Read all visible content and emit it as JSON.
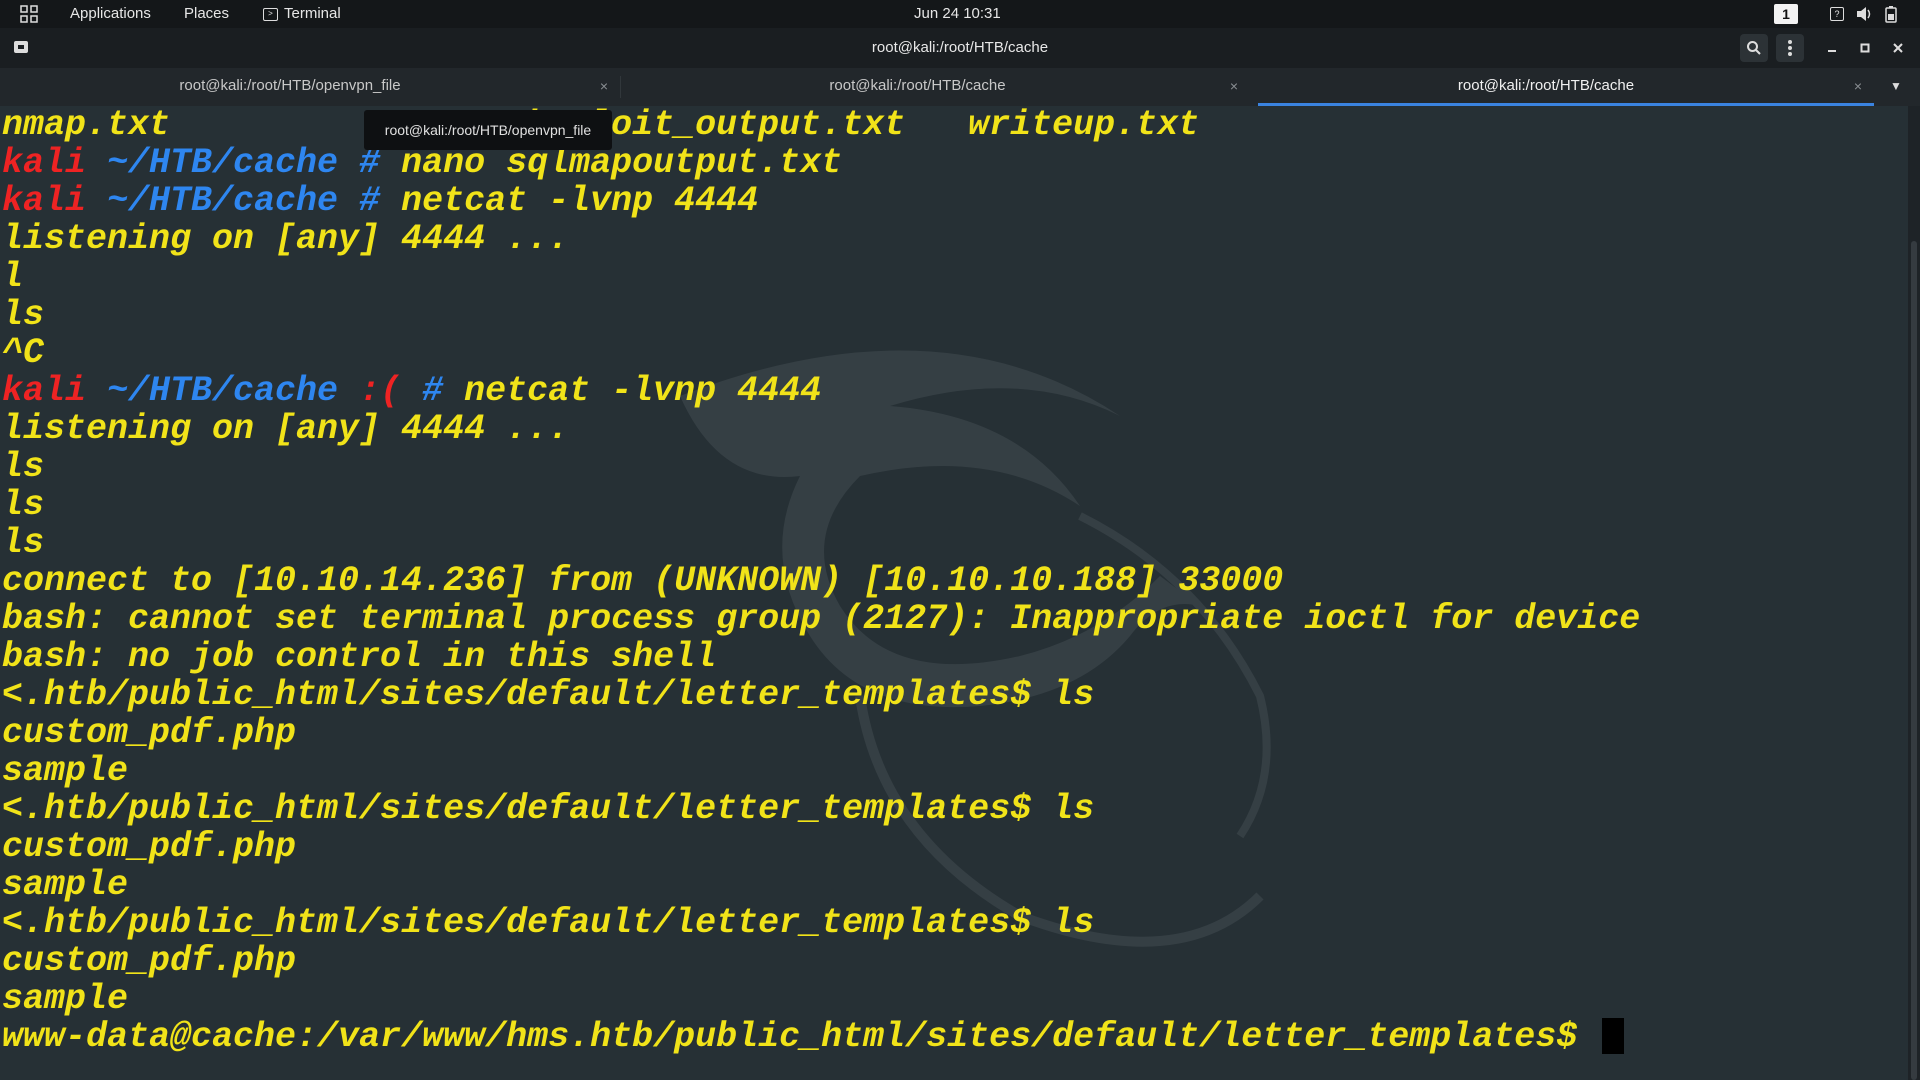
{
  "topbar": {
    "applications": "Applications",
    "places": "Places",
    "terminal": "Terminal",
    "clock": "Jun 24  10:31",
    "workspace": "1"
  },
  "titlebar": {
    "title": "root@kali:/root/HTB/cache"
  },
  "tabs": [
    {
      "label": "root@kali:/root/HTB/openvpn_file",
      "close": "×",
      "active": false
    },
    {
      "label": "root@kali:/root/HTB/cache",
      "close": "×",
      "active": false
    },
    {
      "label": "root@kali:/root/HTB/cache",
      "close": "×",
      "active": true
    }
  ],
  "tooltip": "root@kali:/root/HTB/openvpn_file",
  "terminal": {
    "lines": [
      "nmap.txt            searchsploit_output.txt   writeup.txt",
      "kali ~/HTB/cache # nano sqlmapoutput.txt",
      "kali ~/HTB/cache # netcat -lvnp 4444",
      "listening on [any] 4444 ...",
      "l",
      "ls",
      "^C",
      "kali ~/HTB/cache :( # netcat -lvnp 4444",
      "listening on [any] 4444 ...",
      "ls",
      "ls",
      "ls",
      "connect to [10.10.14.236] from (UNKNOWN) [10.10.10.188] 33000",
      "bash: cannot set terminal process group (2127): Inappropriate ioctl for device",
      "bash: no job control in this shell",
      "<.htb/public_html/sites/default/letter_templates$ ls",
      "custom_pdf.php",
      "sample",
      "<.htb/public_html/sites/default/letter_templates$ ls",
      "custom_pdf.php",
      "sample",
      "<.htb/public_html/sites/default/letter_templates$ ls",
      "custom_pdf.php",
      "sample",
      "www-data@cache:/var/www/hms.htb/public_html/sites/default/letter_templates$ "
    ],
    "prompt_parts": {
      "user": "kali",
      "path": "~/HTB/cache",
      "sad": ":(",
      "hash": "#"
    },
    "colors": {
      "output": "#f1e319",
      "user": "#ee2323",
      "path": "#2e86f0",
      "background": "#263035"
    }
  }
}
